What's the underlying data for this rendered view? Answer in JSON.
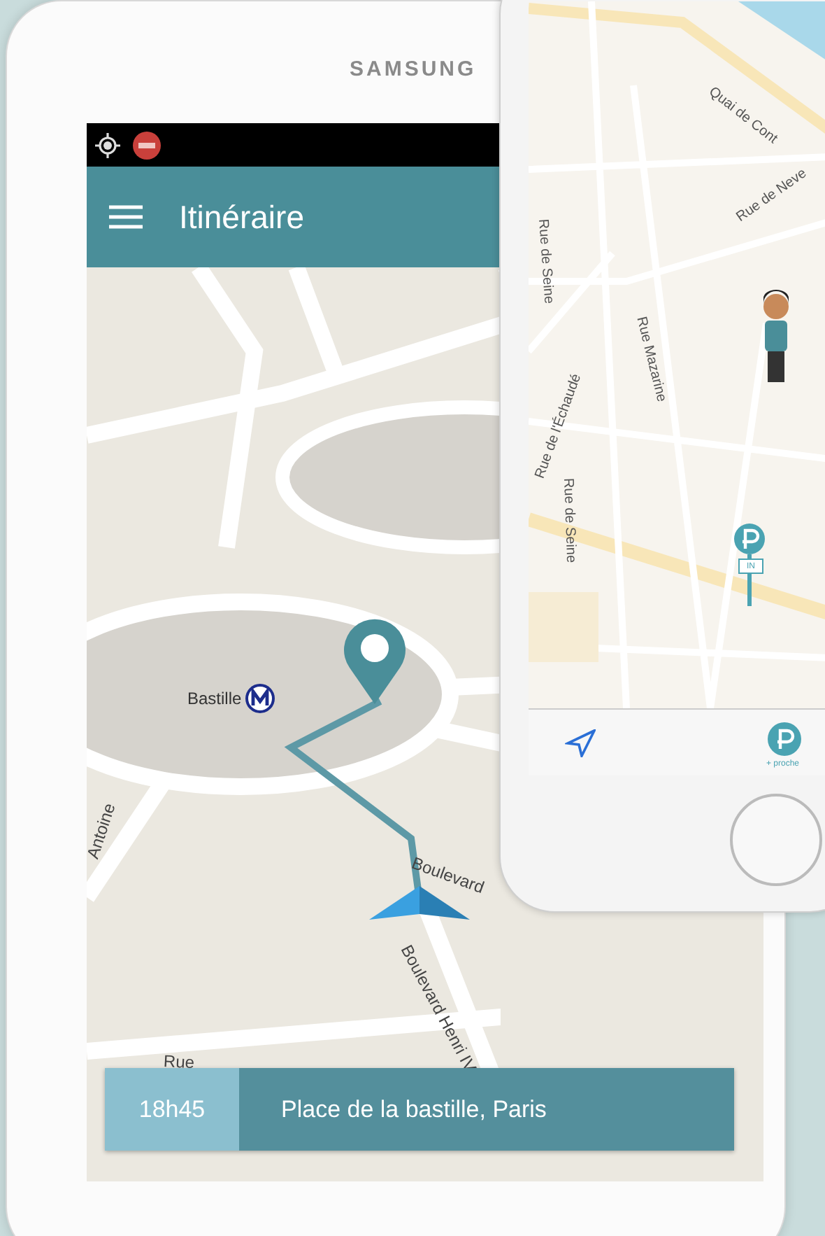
{
  "tablet": {
    "brand": "SAMSUNG",
    "app_bar": {
      "title": "Itinéraire"
    },
    "map": {
      "labels": [
        {
          "text": "Bastille",
          "kind": "metro"
        },
        {
          "text": "Boulevard",
          "kind": "street"
        },
        {
          "text": "Boulevard Henri IV",
          "kind": "street"
        },
        {
          "text": "Rue",
          "kind": "street"
        },
        {
          "text": "Antoine",
          "kind": "street"
        }
      ]
    },
    "bottom_bar": {
      "time": "18h45",
      "destination": "Place de la bastille, Paris"
    }
  },
  "phone": {
    "map": {
      "labels": [
        {
          "text": "Quai de Cont",
          "kind": "street"
        },
        {
          "text": "Rue de Seine",
          "kind": "street"
        },
        {
          "text": "Rue de Seine",
          "kind": "street"
        },
        {
          "text": "Rue Mazarine",
          "kind": "street"
        },
        {
          "text": "Rue de l'Échaudé",
          "kind": "street"
        },
        {
          "text": "Rue de Neve",
          "kind": "street"
        }
      ],
      "parking_sign": "IN"
    },
    "tab_bar": {
      "nearest_label": "+ proche"
    }
  }
}
